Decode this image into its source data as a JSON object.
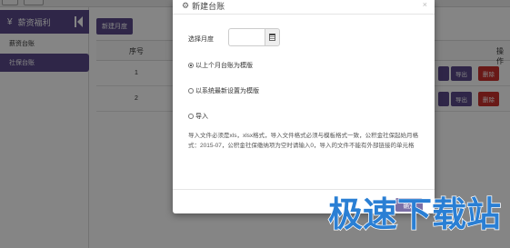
{
  "sidebar": {
    "header_label": "薪资福利",
    "header_icon": "yen-icon",
    "items": [
      {
        "label": "薪资台账",
        "active": false
      },
      {
        "label": "社保台账",
        "active": true
      }
    ]
  },
  "content": {
    "new_button_label": "新建月度",
    "table": {
      "headers": {
        "seq": "序号",
        "ops": "操作"
      },
      "rows": [
        {
          "seq": "1",
          "actions": [
            "导出",
            "删除"
          ]
        },
        {
          "seq": "2",
          "actions": [
            "导出",
            "删除"
          ]
        }
      ]
    }
  },
  "modal": {
    "title": "新建台账",
    "title_icon": "gear-icon",
    "close_glyph": "×",
    "month_label": "选择月度",
    "month_value": "",
    "options": [
      {
        "label": "以上个月台账为模版",
        "checked": true
      },
      {
        "label": "以系统最新设置为模版",
        "checked": false
      },
      {
        "label": "导入",
        "checked": false
      }
    ],
    "help_text": "导入文件必须是xls，xlsx格式，导入文件格式必须与模板格式一致，公积金社保起始月格式：2015-07，公积金社保缴纳项为空时请输入0，导入的文件不能有外部链接的单元格",
    "confirm_label": "确定"
  },
  "watermark": {
    "text": "极速下载站"
  },
  "colors": {
    "accent": "#5a4a8a",
    "danger": "#c9302c",
    "overlay": "rgba(0,0,0,0.48)"
  }
}
